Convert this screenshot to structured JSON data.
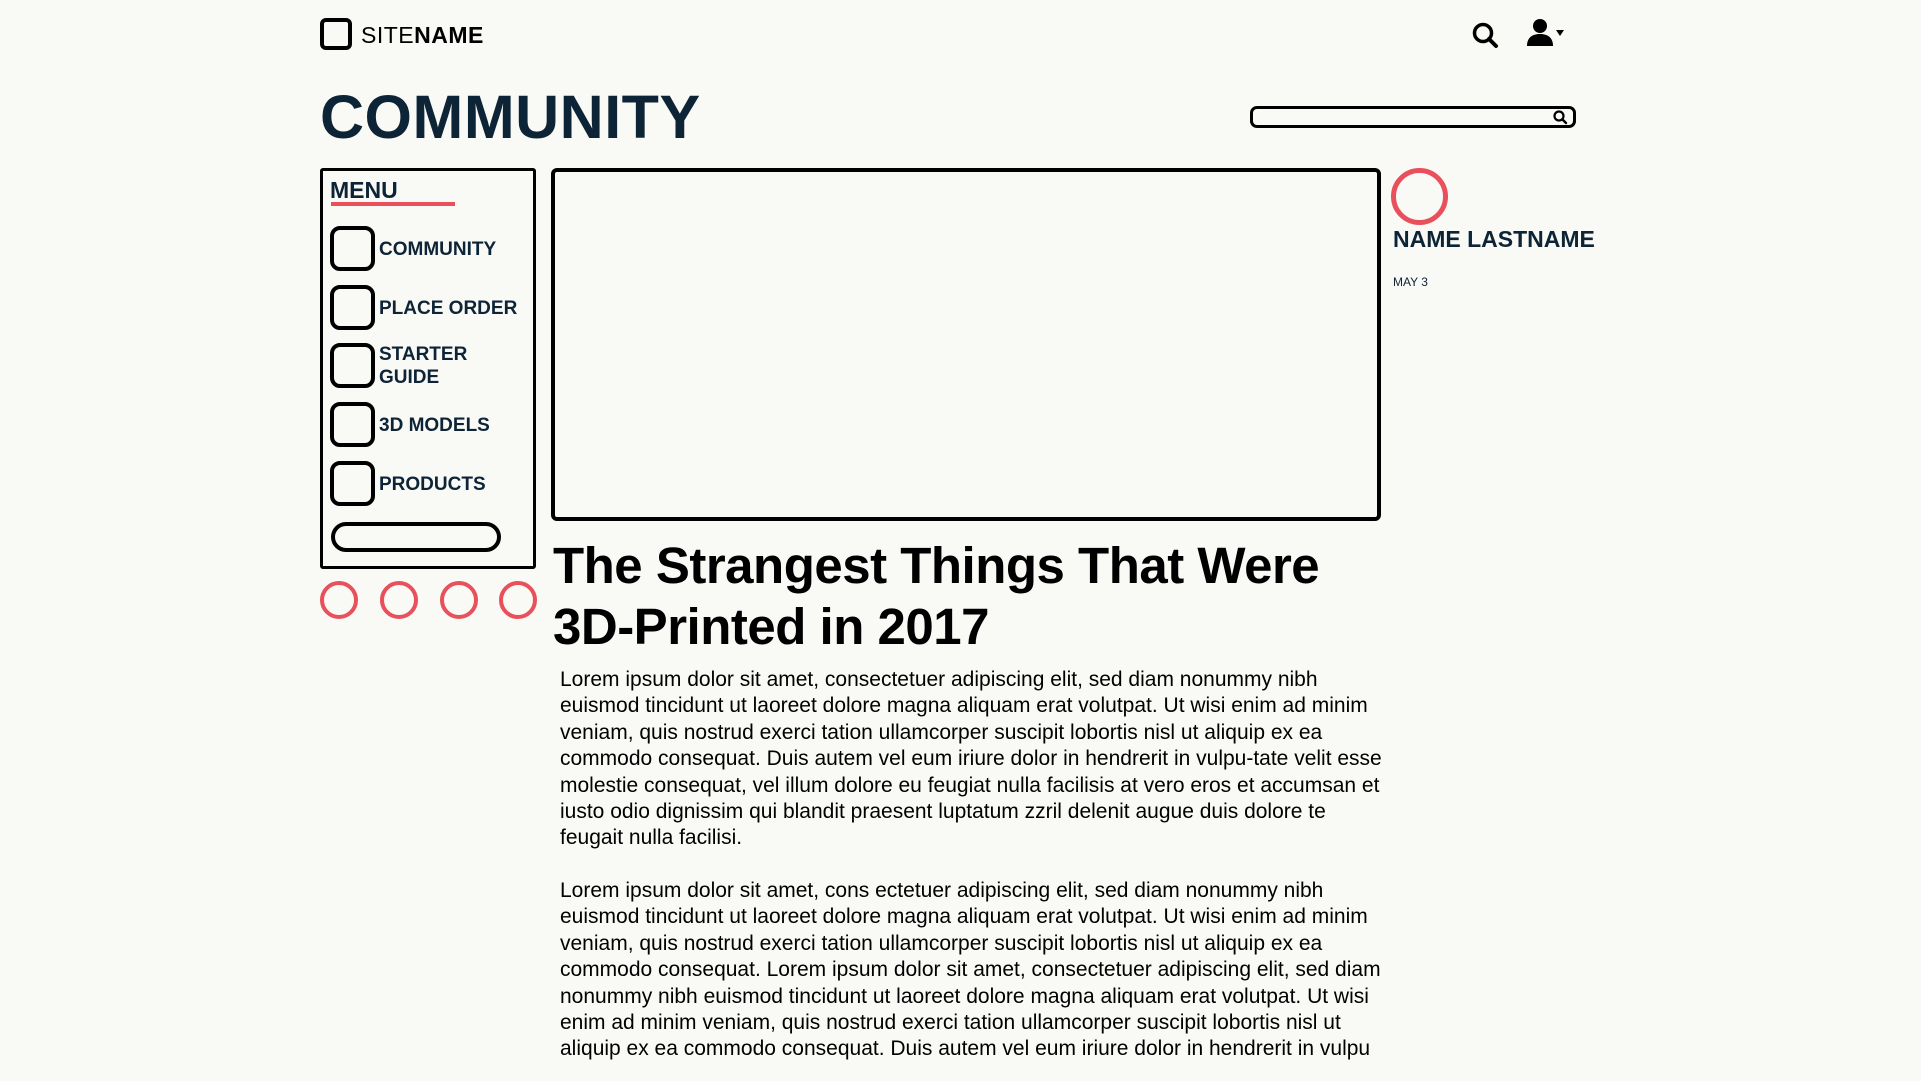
{
  "header": {
    "logo_light": "SITE",
    "logo_bold": "NAME",
    "search_icon": "search-icon",
    "user_icon": "user-dropdown-icon"
  },
  "page": {
    "title": "COMMUNITY"
  },
  "search": {
    "placeholder": "",
    "value": ""
  },
  "menu": {
    "heading": "MENU",
    "items": [
      {
        "label": "COMMUNITY",
        "icon": "placeholder-icon"
      },
      {
        "label": "PLACE ORDER",
        "icon": "placeholder-icon"
      },
      {
        "label": "STARTER GUIDE",
        "icon": "placeholder-icon"
      },
      {
        "label": "3D MODELS",
        "icon": "placeholder-icon"
      },
      {
        "label": "PRODUCTS",
        "icon": "placeholder-icon"
      }
    ],
    "button_label": ""
  },
  "social_circles": 4,
  "article": {
    "title": "The Strangest Things That Were 3D-Printed in 2017",
    "paragraphs": [
      "Lorem ipsum dolor sit amet, consectetuer adipiscing elit, sed diam nonummy nibh euismod tincidunt ut laoreet dolore magna aliquam erat volutpat. Ut wisi enim ad minim veniam, quis nostrud exerci tation ullamcorper suscipit lobortis nisl ut aliquip ex ea commodo consequat. Duis autem vel eum iriure dolor in hendrerit in vulpu-tate velit esse molestie consequat, vel illum dolore eu feugiat nulla facilisis at vero eros et accumsan et iusto odio dignissim qui blandit praesent luptatum zzril delenit augue duis dolore te feugait nulla facilisi.",
      "Lorem ipsum dolor sit amet, cons ectetuer adipiscing elit, sed diam nonummy nibh euismod tincidunt ut laoreet dolore magna aliquam erat volutpat. Ut wisi enim ad minim veniam, quis nostrud exerci tation ullamcorper suscipit lobortis nisl ut aliquip ex ea commodo consequat. Lorem ipsum dolor sit amet, consectetuer adipiscing elit, sed diam nonummy nibh euismod tincidunt ut laoreet dolore magna aliquam erat volutpat. Ut wisi enim ad minim veniam, quis nostrud exerci tation ullamcorper suscipit lobortis nisl ut aliquip ex ea commodo consequat. Duis autem vel eum iriure dolor in hendrerit in vulpu"
    ]
  },
  "author": {
    "name": "NAME LASTNAME",
    "date": "MAY 3"
  },
  "colors": {
    "accent": "#e8505b",
    "navy": "#0d2436",
    "background": "#f9f9f6"
  }
}
